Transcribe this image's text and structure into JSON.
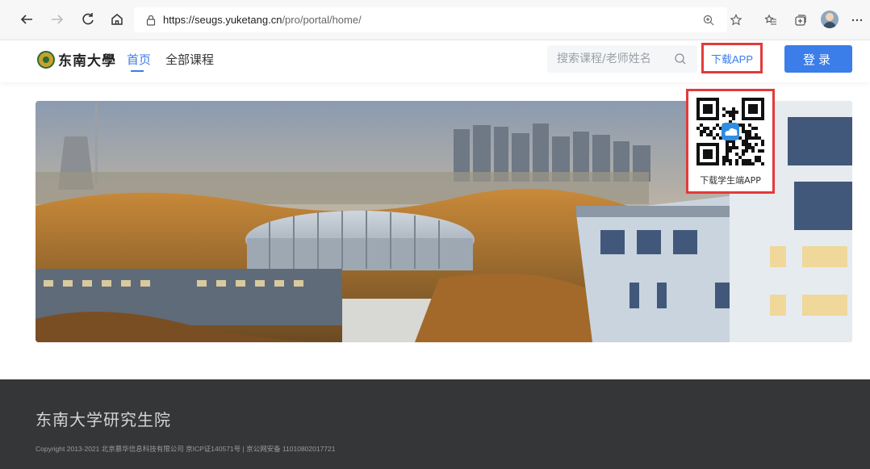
{
  "browser": {
    "url_host": "https://seugs.yuketang.cn",
    "url_path": "/pro/portal/home/"
  },
  "header": {
    "logo_text": "东南大學",
    "nav": [
      {
        "label": "首页",
        "active": true
      },
      {
        "label": "全部课程",
        "active": false
      }
    ],
    "search_placeholder": "搜索课程/老师姓名",
    "download_label": "下载APP",
    "login_label": "登录"
  },
  "qr_popup": {
    "caption": "下载学生端APP"
  },
  "footer": {
    "title": "东南大学研究生院",
    "copyright": "Copyright 2013-2021 北京慕华信息科技有限公司 京ICP证140571号 | 京公网安备 11010802017721"
  },
  "colors": {
    "accent": "#3b7de9",
    "highlight_box": "#e23b3b",
    "footer_bg": "#353638"
  }
}
